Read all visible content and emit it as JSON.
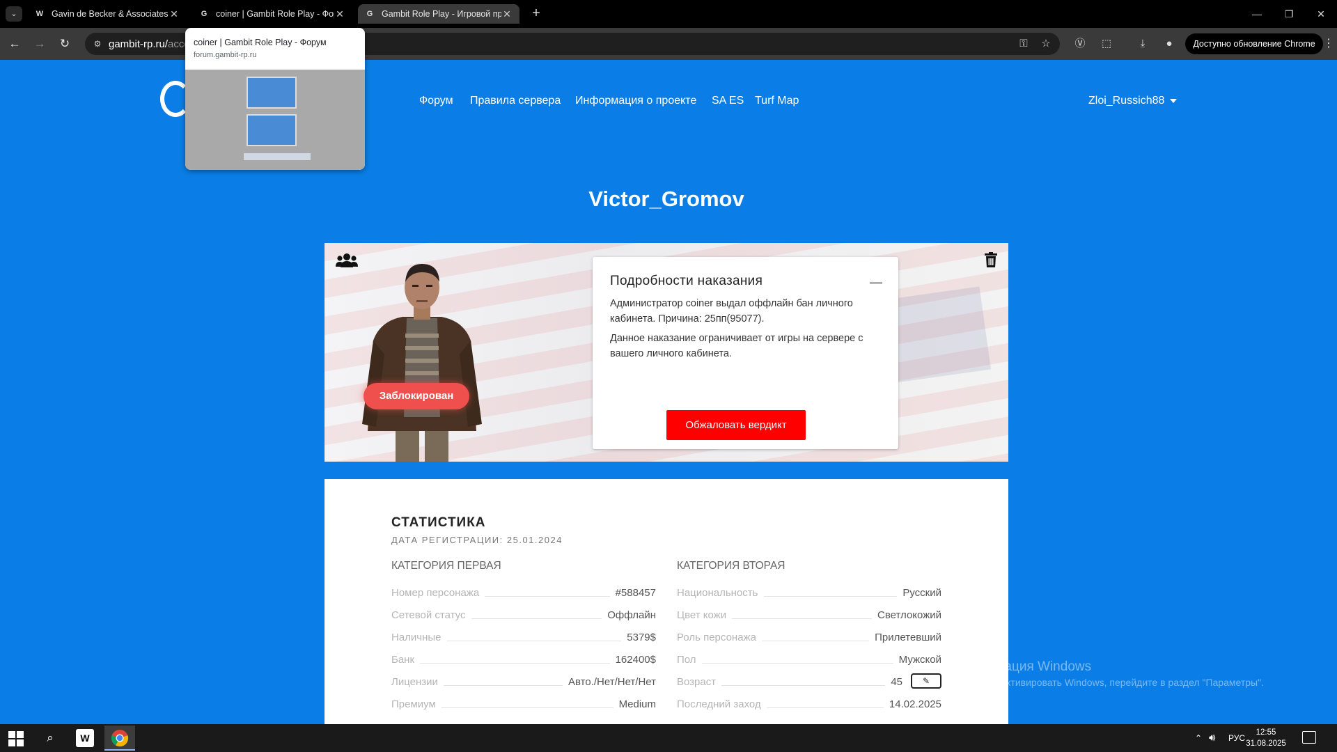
{
  "browser": {
    "tabs": [
      {
        "title": "Gavin de Becker & Associates |",
        "favicon": "gdba-icon",
        "active": false
      },
      {
        "title": "coiner | Gambit Role Play - Форум",
        "favicon": "gambit-icon",
        "active": false
      },
      {
        "title": "Gambit Role Play - Игровой про",
        "favicon": "gambit-icon",
        "active": true
      }
    ],
    "url_host": "gambit-rp.ru/",
    "url_path": "acco",
    "update_label": "Доступно обновление Chrome",
    "tab_preview": {
      "title": "coiner | Gambit Role Play - Форум",
      "host": "forum.gambit-rp.ru"
    }
  },
  "site": {
    "nav": [
      "Форум",
      "Правила сервера",
      "Информация о проекте",
      "SA ES",
      "Turf Map"
    ],
    "user": "Zloi_Russich88"
  },
  "profile": {
    "name": "Victor_Gromov",
    "status_badge": "Заблокирован",
    "punishment": {
      "title": "Подробности наказания",
      "minimize": "—",
      "text1": "Администратор coiner выдал оффлайн бан личного кабинета. Причина: 25пп(95077).",
      "text2": "Данное наказание ограничивает от игры на сервере с вашего личного кабинета.",
      "appeal_label": "Обжаловать вердикт"
    }
  },
  "stats": {
    "title": "СТАТИСТИКА",
    "registration": "ДАТА РЕГИСТРАЦИИ: 25.01.2024",
    "category1": {
      "title": "КАТЕГОРИЯ ПЕРВАЯ",
      "rows": [
        {
          "label": "Номер персонажа",
          "value": "#588457"
        },
        {
          "label": "Сетевой статус",
          "value": "Оффлайн"
        },
        {
          "label": "Наличные",
          "value": "5379$"
        },
        {
          "label": "Банк",
          "value": "162400$"
        },
        {
          "label": "Лицензии",
          "value": "Авто./Нет/Нет/Нет"
        },
        {
          "label": "Премиум",
          "value": "Medium"
        }
      ]
    },
    "category2": {
      "title": "КАТЕГОРИЯ ВТОРАЯ",
      "rows": [
        {
          "label": "Национальность",
          "value": "Русский"
        },
        {
          "label": "Цвет кожи",
          "value": "Светлокожий"
        },
        {
          "label": "Роль персонажа",
          "value": "Прилетевший"
        },
        {
          "label": "Пол",
          "value": "Мужской"
        },
        {
          "label": "Возраст",
          "value": "45"
        },
        {
          "label": "Последний заход",
          "value": "14.02.2025"
        }
      ]
    }
  },
  "watermark": {
    "title": "Активация Windows",
    "subtitle": "Чтобы активировать Windows, перейдите в раздел \"Параметры\"."
  },
  "taskbar": {
    "language": "РУС",
    "time": "12:55",
    "date": "31.08.2025"
  },
  "colors": {
    "page_bg": "#0a7ee6",
    "appeal_button": "#ff0000",
    "banned_badge": "#f0504d"
  }
}
